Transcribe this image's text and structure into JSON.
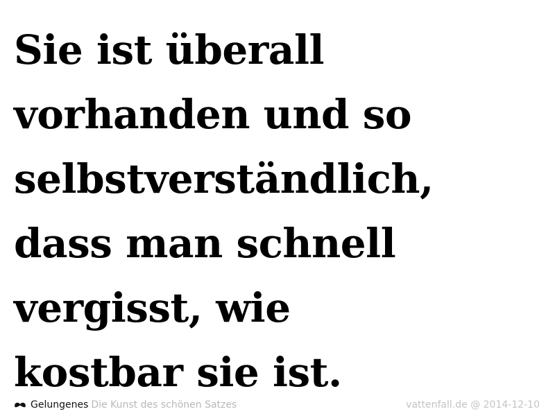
{
  "quote": {
    "lines": [
      "Sie ist überall",
      "vorhanden und so",
      "selbstverständlich,",
      "dass man schnell",
      "vergisst, wie",
      "kostbar sie ist."
    ]
  },
  "footer": {
    "brand": "Gelungenes",
    "tagline": "Die Kunst des schönen Satzes",
    "source": "vattenfall.de @ 2014-12-10",
    "logo_icon": "mustache-icon"
  },
  "colors": {
    "text": "#000000",
    "muted": "#b8b8b8",
    "background": "#ffffff"
  }
}
